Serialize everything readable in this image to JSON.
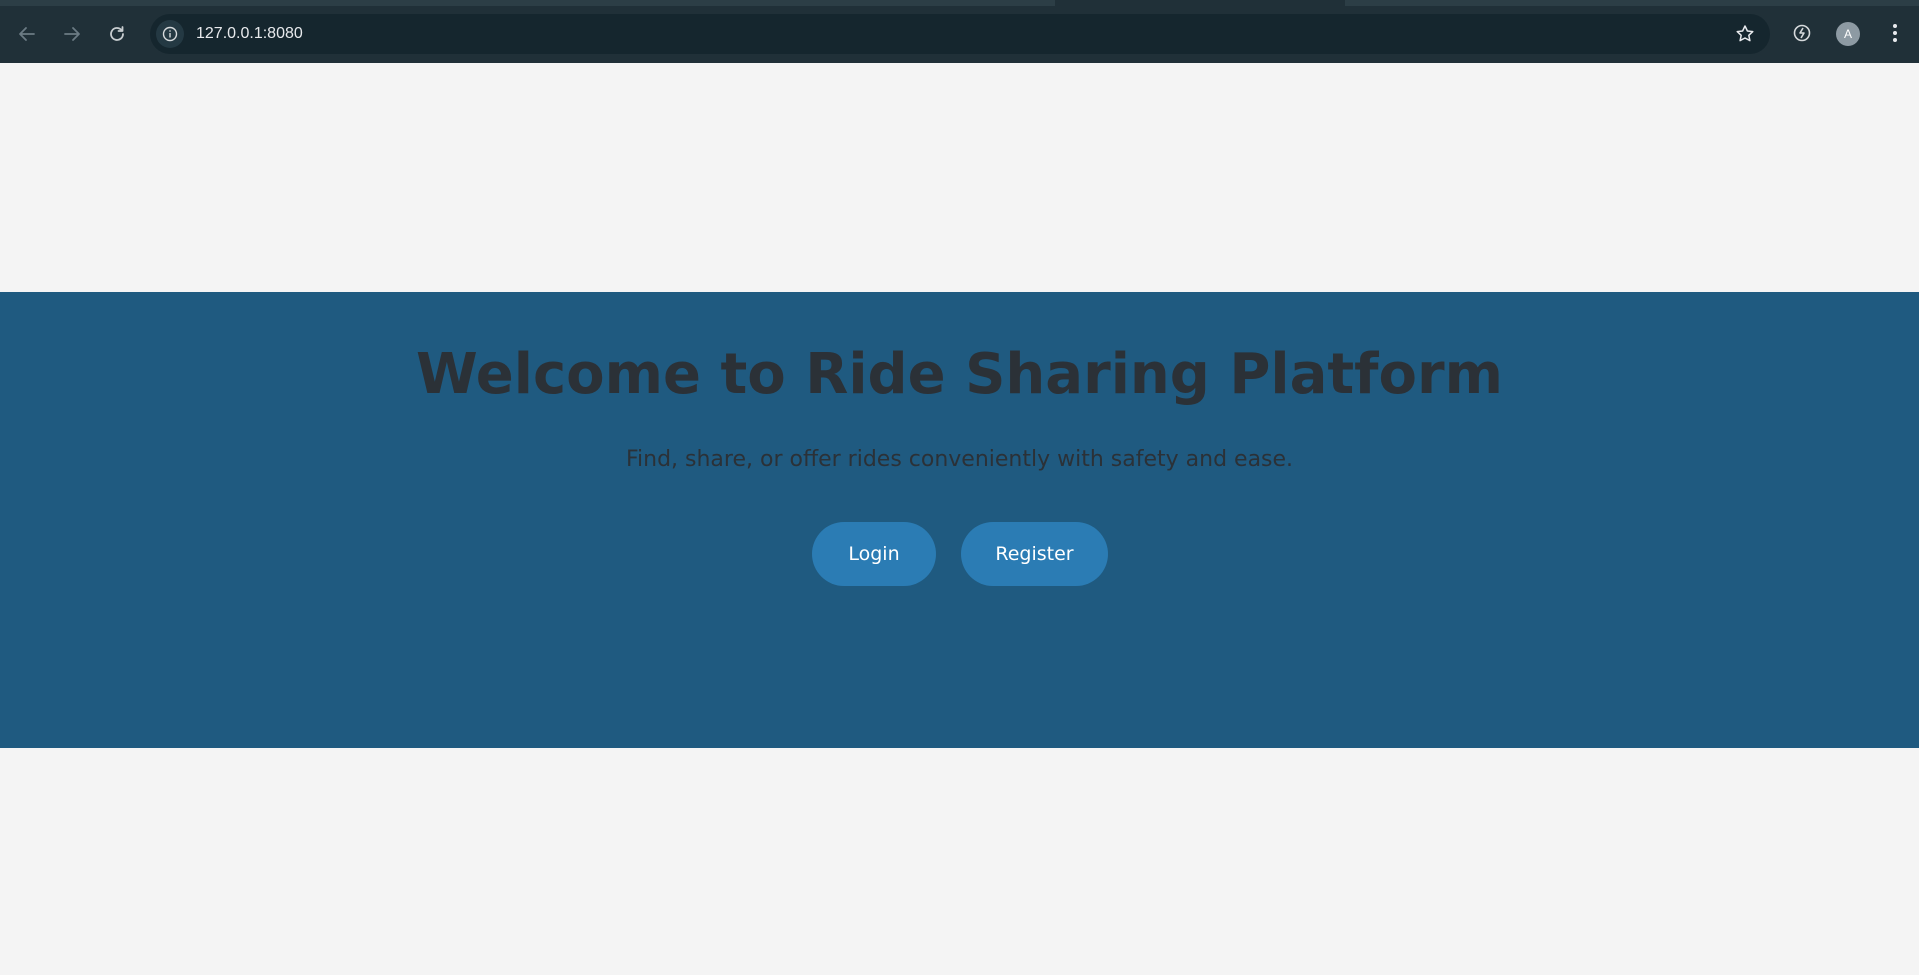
{
  "browser": {
    "url": "127.0.0.1:8080",
    "profile_initial": "A",
    "icons": {
      "back": "arrow-left-icon",
      "forward": "arrow-right-icon",
      "reload": "reload-icon",
      "site_info": "info-icon",
      "bookmark": "star-icon",
      "extensions": "extensions-icon",
      "menu": "kebab-menu-icon"
    }
  },
  "hero": {
    "title": "Welcome to Ride Sharing Platform",
    "subtitle": "Find, share, or offer rides conveniently with safety and ease.",
    "buttons": {
      "login_label": "Login",
      "register_label": "Register"
    }
  },
  "colors": {
    "hero_background": "#1f5a80",
    "button_background": "#2b7cb4",
    "page_background": "#f4f4f4",
    "heading_text": "#2b3137"
  }
}
